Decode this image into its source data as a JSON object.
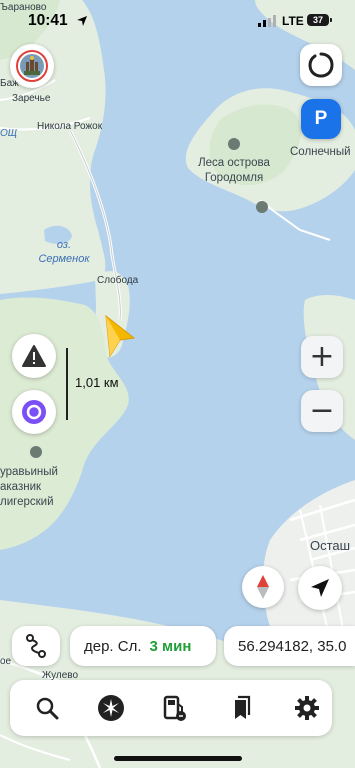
{
  "status_bar": {
    "time": "10:41",
    "network": "LTE",
    "battery": "37"
  },
  "map": {
    "place_labels": {
      "baranovo": "Ъараново",
      "bazh": "Баж",
      "zarechye": "Заречье",
      "nikola_rozhok": "Никола Рожок",
      "okh": "ОЩ",
      "forest_line1": "Леса острова",
      "forest_line2": "Городомля",
      "solnechny": "Солнечный",
      "lake_line1": "оз.",
      "lake_line2": "Серменок",
      "sloboda": "Слобода",
      "reserve_line1": "уравьиный",
      "reserve_line2": "аказник",
      "reserve_line3": "лигерский",
      "ostash": "Осташ",
      "oe": "ое",
      "zhulevo": "Жулево"
    },
    "scale_label": "1,01 км",
    "colors": {
      "water": "#b5d2ec",
      "land": "#e5efe0",
      "forest": "#cfe5c4",
      "arrow": "#f5b800",
      "parking": "#1a73e8"
    }
  },
  "controls": {
    "avatar_icon": "profile-avatar-icon",
    "layers_icon": "layers-circle-icon",
    "parking_label": "P",
    "zoom_in_label": "+",
    "zoom_out_label": "−"
  },
  "route": {
    "destination": "дер. Сл.",
    "duration": "3 мин"
  },
  "coordinates": "56.294182, 35.0",
  "toolbar": [
    "search-icon",
    "discovery-icon",
    "gas-station-icon",
    "bookmarks-icon",
    "settings-icon"
  ]
}
